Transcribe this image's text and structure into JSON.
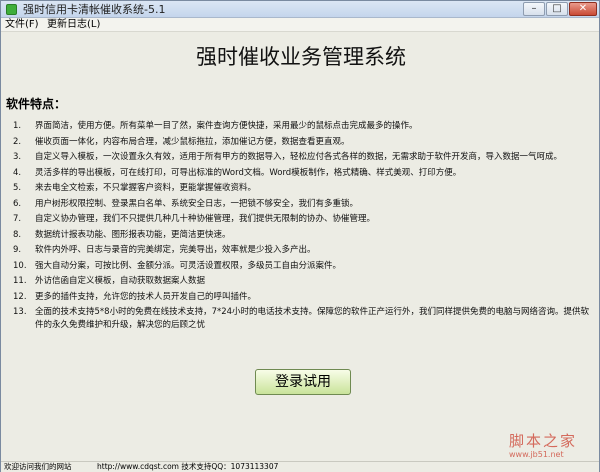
{
  "window": {
    "title": "强时信用卡清帐催收系统-5.1",
    "min_glyph": "–",
    "max_glyph": "□",
    "close_glyph": "✕"
  },
  "menu": {
    "file": "文件(F)",
    "update_log": "更新日志(L)"
  },
  "main_title": "强时催收业务管理系统",
  "features_heading": "软件特点：",
  "features": [
    {
      "num": "1.",
      "text": "界面简洁，使用方便。所有菜单一目了然，案件查询方便快捷，采用最少的鼠标点击完成最多的操作。"
    },
    {
      "num": "2.",
      "text": "催收页面一体化，内容布局合理，减少鼠标拖拉，添加催记方便，数据查看更直观。"
    },
    {
      "num": "3.",
      "text": "自定义导入模板，一次设置永久有效，适用于所有甲方的数据导入，轻松应付各式各样的数据，无需求助于软件开发商，导入数据一气呵成。"
    },
    {
      "num": "4.",
      "text": "灵活多样的导出模板，可在线打印，可导出标准的Word文档。Word模板制作，格式精确、样式美观、打印方便。"
    },
    {
      "num": "5.",
      "text": "来去电全文检索，不只掌握客户资料，更能掌握催收资料。"
    },
    {
      "num": "6.",
      "text": "用户树形权限控制、登录黑白名单、系统安全日志，一把锁不够安全，我们有多重锁。"
    },
    {
      "num": "7.",
      "text": "自定义协办管理，我们不只提供几种几十种协催管理，我们提供无限制的协办、协催管理。"
    },
    {
      "num": "8.",
      "text": "数据统计报表功能、图形报表功能，更简洁更快速。"
    },
    {
      "num": "9.",
      "text": "软件内外呼、日志与录音的完美绑定，完美导出，效率就是少投入多产出。"
    },
    {
      "num": "10.",
      "text": "强大自动分案，可按比例、金额分派。可灵活设置权限，多级员工自由分派案件。"
    },
    {
      "num": "11.",
      "text": "外访信函自定义模板，自动获取数据案人数据"
    },
    {
      "num": "12.",
      "text": "更多的插件支持，允许您的技术人员开发自己的呼叫插件。"
    },
    {
      "num": "13.",
      "text": "全面的技术支持5*8小时的免费在线技术支持，7*24小时的电话技术支持。保障您的软件正产运行外，我们同样提供免费的电脑与网络咨询。提供软件的永久免费维护和升级，解决您的后顾之忧"
    }
  ],
  "login_button": "登录试用",
  "watermark": {
    "line1": "脚本之家",
    "line2": "www.jb51.net"
  },
  "status": {
    "link": "欢迎访问我们的网站",
    "info": "http://www.cdqst.com  技术支持QQ：1073113307"
  }
}
